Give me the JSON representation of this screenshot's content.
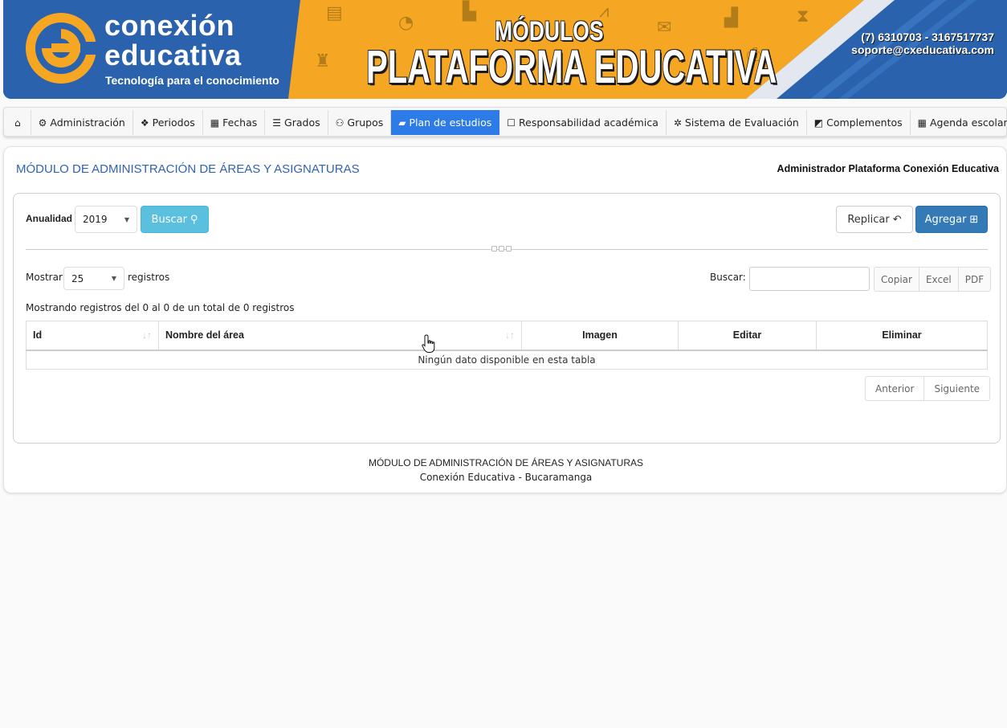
{
  "banner": {
    "brand_line1": "conexión",
    "brand_line2": "educativa",
    "tagline": "Tecnología para el conocimiento",
    "modulos": "MÓDULOS",
    "platform": "PLATAFORMA EDUCATIVA",
    "phone": "(7) 6310703 - 3167517737",
    "email": "soporte@cxeducativa.com",
    "colors": {
      "blue": "#2a62ad",
      "orange": "#f5a623"
    }
  },
  "nav": {
    "items": [
      {
        "icon": "home-icon",
        "label": ""
      },
      {
        "icon": "gears-icon",
        "label": "Administración"
      },
      {
        "icon": "cubes-icon",
        "label": "Periodos"
      },
      {
        "icon": "calendar-icon",
        "label": "Fechas"
      },
      {
        "icon": "list-ol-icon",
        "label": "Grados"
      },
      {
        "icon": "users-icon",
        "label": "Grupos"
      },
      {
        "icon": "book-icon",
        "label": "Plan de estudios",
        "active": true
      },
      {
        "icon": "square-icon",
        "label": "Responsabilidad académica"
      },
      {
        "icon": "cog-icon",
        "label": "Sistema de Evaluación"
      },
      {
        "icon": "external-link-icon",
        "label": "Complementos"
      },
      {
        "icon": "calendar-icon",
        "label": "Agenda escolar"
      }
    ],
    "active_color": "#2d7be8"
  },
  "page": {
    "title": "MÓDULO DE ADMINISTRACIÓN DE ÁREAS Y ASIGNATURAS",
    "user": "Administrador Plataforma Conexión Educativa"
  },
  "filters": {
    "anualidad_label": "Anualidad",
    "anualidad_value": "2019",
    "buscar_button": "Buscar",
    "replicar_button": "Replicar",
    "agregar_button": "Agregar"
  },
  "table_controls": {
    "mostrar_label": "Mostrar",
    "mostrar_value": "25",
    "registros_label": "registros",
    "search_label": "Buscar:",
    "search_value": "",
    "export_buttons": [
      "Copiar",
      "Excel",
      "PDF"
    ],
    "info": "Mostrando registros del 0 al 0 de un total de 0 registros"
  },
  "table": {
    "columns": [
      "Id",
      "Nombre del área",
      "Imagen",
      "Editar",
      "Eliminar"
    ],
    "empty_message": "Ningún dato disponible en esta tabla"
  },
  "pagination": {
    "prev": "Anterior",
    "next": "Siguiente"
  },
  "footer": {
    "title": "MÓDULO DE ADMINISTRACIÓN DE ÁREAS Y ASIGNATURAS",
    "subtitle": "Conexión Educativa - Bucaramanga"
  }
}
